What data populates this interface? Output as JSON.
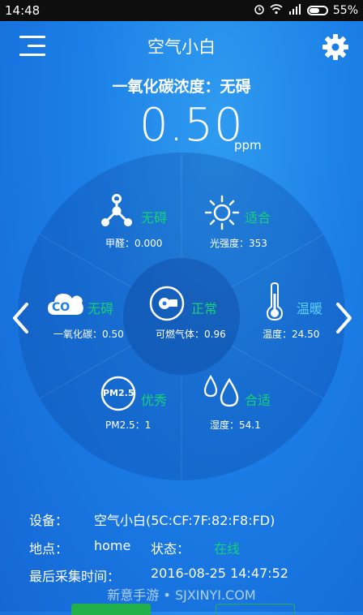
{
  "status_bar": {
    "time": "14:48",
    "battery": "55%"
  },
  "header": {
    "title": "空气小白"
  },
  "headline": "一氧化碳浓度：无碍",
  "main_reading": {
    "value": "0.50",
    "unit": "ppm"
  },
  "sensors": {
    "formaldehyde": {
      "status": "无碍",
      "label": "甲醛：0.000"
    },
    "light": {
      "status": "适合",
      "label": "光强度：353"
    },
    "co": {
      "status": "无碍",
      "label": "一氧化碳：0.50",
      "badge": "CO"
    },
    "gas": {
      "status": "正常",
      "label": "可燃气体：0.96"
    },
    "temperature": {
      "status": "温暖",
      "label": "温度：24.50"
    },
    "pm25": {
      "status": "优秀",
      "label": "PM2.5：1",
      "badge": "PM2.5"
    },
    "humidity": {
      "status": "合适",
      "label": "湿度：54.1"
    }
  },
  "info": {
    "device_label": "设备：",
    "device_value": "空气小白(5C:CF:7F:82:F8:FD)",
    "location_label": "地点：",
    "location_value": "home",
    "state_label": "状态：",
    "state_value": "在线",
    "last_time_label": "最后采集时间：",
    "last_time_value": "2016-08-25 14:47:52"
  },
  "watermark": "新意手游 • SJXINYI.COM",
  "colors": {
    "green": "#16d07a",
    "light_blue": "#5fd0ff",
    "accent_button": "#22b04a"
  },
  "icons": [
    "menu-icon",
    "gear-icon",
    "molecule-icon",
    "sun-icon",
    "cloud-icon",
    "gas-meter-icon",
    "thermometer-icon",
    "droplets-icon",
    "chevron-left-icon",
    "chevron-right-icon"
  ]
}
